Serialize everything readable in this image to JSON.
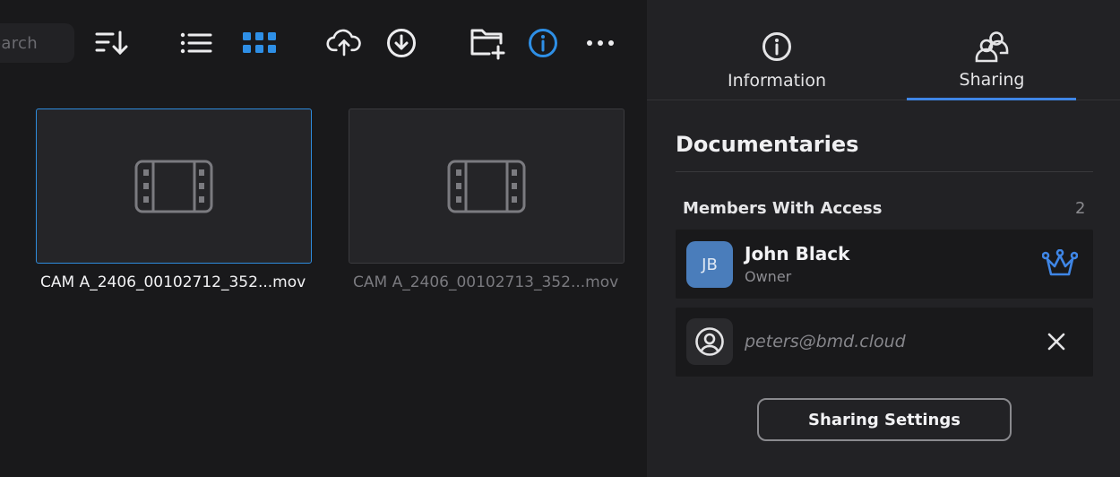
{
  "toolbar": {
    "search_placeholder": "earch",
    "icons": [
      "sort-icon",
      "list-view-icon",
      "grid-view-icon",
      "upload-cloud-icon",
      "download-icon",
      "new-folder-icon",
      "info-icon",
      "more-icon"
    ]
  },
  "files": [
    {
      "name": "CAM A_2406_00102712_352...mov",
      "selected": true
    },
    {
      "name": "CAM A_2406_00102713_352...mov",
      "selected": false
    }
  ],
  "panel": {
    "tabs": [
      {
        "label": "Information",
        "active": false
      },
      {
        "label": "Sharing",
        "active": true
      }
    ],
    "folder_title": "Documentaries",
    "members_heading": "Members With Access",
    "members_count": "2",
    "members": [
      {
        "initials": "JB",
        "name": "John Black",
        "role": "Owner"
      },
      {
        "email": "peters@bmd.cloud"
      }
    ],
    "sharing_settings_label": "Sharing Settings"
  },
  "colors": {
    "accent": "#3f86e6",
    "selection": "#2e8bdc",
    "avatar": "#4a7dbb",
    "background": "#19191b",
    "panel": "#222225"
  }
}
